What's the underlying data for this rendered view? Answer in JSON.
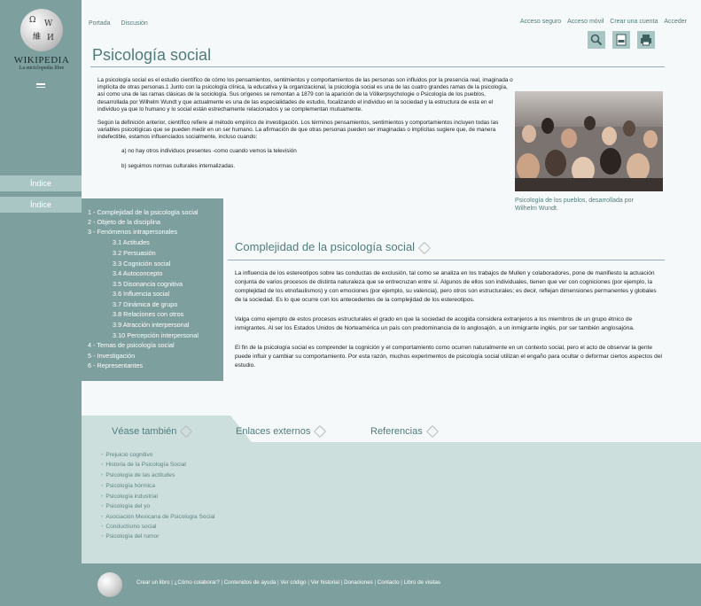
{
  "logo": {
    "name": "WIKIPEDIA",
    "tagline": "La enciclopedia libre"
  },
  "top_nav": {
    "left": [
      "Portada",
      "Discusión"
    ],
    "right": [
      "Acceso seguro",
      "Acceso móvil",
      "Crear una cuenta",
      "Acceder"
    ]
  },
  "tools": [
    "search-icon",
    "pdf-icon",
    "print-icon"
  ],
  "side_tabs": [
    "Índice",
    "Índice"
  ],
  "page_title": "Psicología social",
  "intro": {
    "p1": "La psicología social es el estudio científico de cómo los pensamientos, sentimientos y comportamientos de las personas son influidos por la presencia real, imaginada o implícita de otras personas.1 Junto con la psicología clínica, la educativa y la organizacional, la psicología social es una de las cuatro grandes ramas de la psicología, así como una de las ramas clásicas de la sociología. Sus orígenes se remontan a 1879 con la aparición de la Völkerpsychologie o Psicología de los pueblos, desarrollada por Wilhelm Wundt y que actualmente es una de las especialidades de estudio, focalizando el individuo en la sociedad y la estructura de esta en el individuo ya que lo humano y lo social están estrechamente relacionados y se complementan mutuamente.",
    "p2": "Según la definición anterior, científico refiere al método empírico de investigación. Los términos pensamientos, sentimientos y comportamientos incluyen todas las variables psicológicas que se pueden medir en un ser humano. La afirmación de que otras personas pueden ser imaginadas o implícitas sugiere que, de manera indefectible, estamos influenciados socialmente, incluso cuando:",
    "li1": "a) no hay otros individuos presentes -como cuando vemos la televisión",
    "li2": "b) seguimos normas culturales internalizadas."
  },
  "figure_caption": "Psicología de los pueblos, desarrollada por Wilhelm Wundt.",
  "toc": [
    "1 - Complejidad de la psicología social",
    "2 - Objeto de la disciplina",
    "3 - Fenómenos intrapersonales",
    "3.1 Actitudes",
    "3.2 Persuasión",
    "3.3 Cognición social",
    "3.4 Autoconcepto",
    "3.5 Disonancia cognitiva",
    "3.6 Influencia social",
    "3.7 Dinámica de grupo",
    "3.8 Relaciones con otros",
    "3.9 Atracción interpersonal",
    "3.10 Percepción interpersonal",
    "4 - Temas de psicología social",
    "5 - Investigación",
    "6 - Representantes"
  ],
  "section": {
    "title": "Complejidad de la psicología social",
    "p1": "La influencia de los estereotipos sobre las conductas de exclusión, tal como se analiza en los trabajos de Mullen y colaboradores, pone de manifiesto la actuación conjunta de varios procesos de distinta naturaleza que se entrecruzan entre sí. Algunos de ellos son individuales, tienen que ver con cogniciones (por ejemplo, la complejidad de los etnofaulismos) y con emociones (por ejemplo, su valencia), pero otros son estructurales; es decir, reflejan dimensiones permanentes y globales de la sociedad. Es lo que ocurre con los antecedentes de la complejidad de los estereotipos.",
    "p2": "Valga como ejemplo de estos procesos estructurales el grado en que la sociedad de acogida considera extranjeros a los miembros de un grupo étnico de inmigrantes. Al ser los Estados Unidos de Norteamérica un país con predominancia de lo anglosajón, a un inmigrante inglés, por ser también anglosajóna.",
    "p3": "El fin de la psicología social es comprender la cognición y el comportamiento como ocurren naturalmente en un contexto social, pero el acto de observar la gente puede influir y cambiar su comportamiento. Por esta razón, muchos experimentos de psicología social utilizan el engaño para ocultar o deformar ciertos aspectos del estudio."
  },
  "bottom_tabs": [
    "Véase también",
    "Enlaces externos",
    "Referencias"
  ],
  "see_also": [
    "Prejuicio cognitivo",
    "Historia de la Psicología Social",
    "Psicología de las actitudes",
    "Psicología hórmica",
    "Psicología industrial",
    "Psicología del yo",
    "Asociación Mexicana de Psicología Social",
    "Conductismo social",
    "Psicología del rumor"
  ],
  "footer_links": [
    "Crear un libro",
    "¿Cómo colaborar?",
    "Contenidos de ayuda",
    "Ver código",
    "Ver historial",
    "Donaciones",
    "Contacto",
    "Libro de visitas"
  ]
}
